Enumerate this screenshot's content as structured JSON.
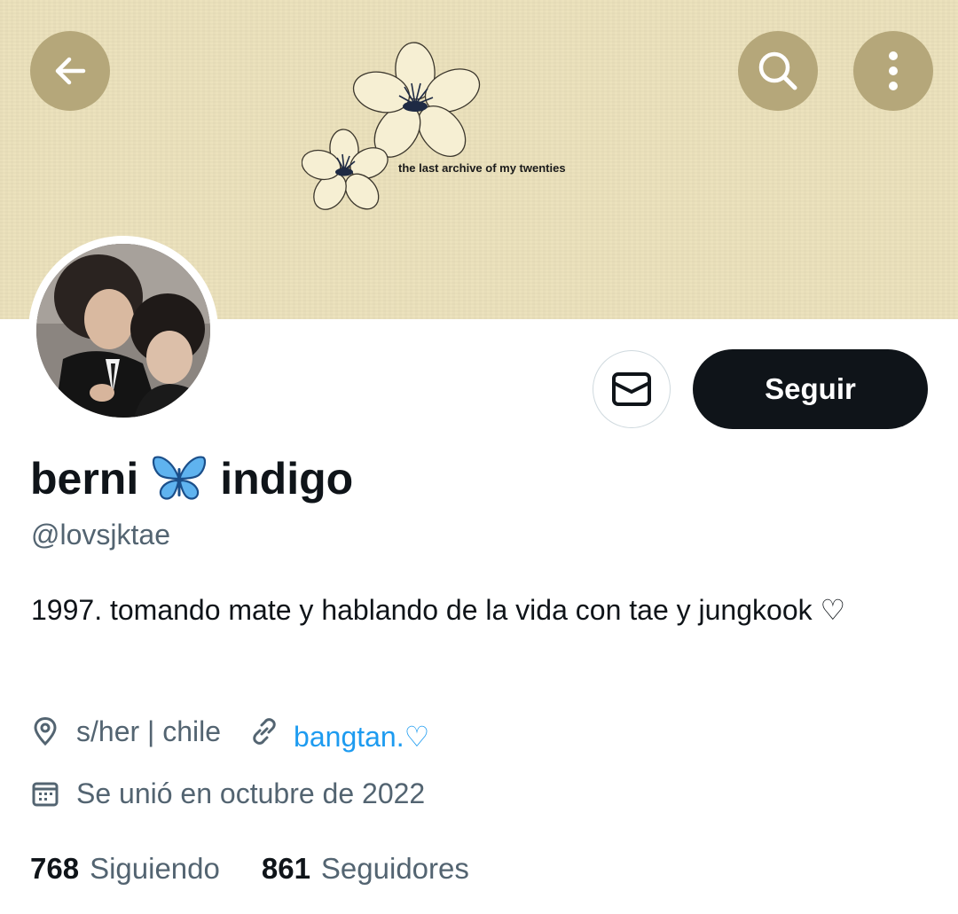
{
  "banner": {
    "text": "the last archive of my twenties",
    "background_color": "#ece2bd"
  },
  "header_buttons": {
    "back_icon": "arrow-left-icon",
    "search_icon": "search-icon",
    "more_icon": "more-vertical-icon",
    "button_color": "#b5a77a"
  },
  "actions": {
    "message_icon": "envelope-icon",
    "follow_label": "Seguir"
  },
  "profile": {
    "name_first": "berni",
    "name_emoji": "butterfly-icon",
    "name_last": "indigo",
    "handle": "@lovsjktae",
    "bio": "1997. tomando mate y hablando de la vida con tae y jungkook ♡",
    "location": "s/her | chile",
    "website": "bangtan.♡",
    "joined": "Se unió en octubre de 2022"
  },
  "stats": {
    "following_count": "768",
    "following_label": "Siguiendo",
    "followers_count": "861",
    "followers_label": "Seguidores"
  },
  "colors": {
    "accent_link": "#1d9bf0",
    "text_primary": "#0f1419",
    "text_secondary": "#536471"
  }
}
